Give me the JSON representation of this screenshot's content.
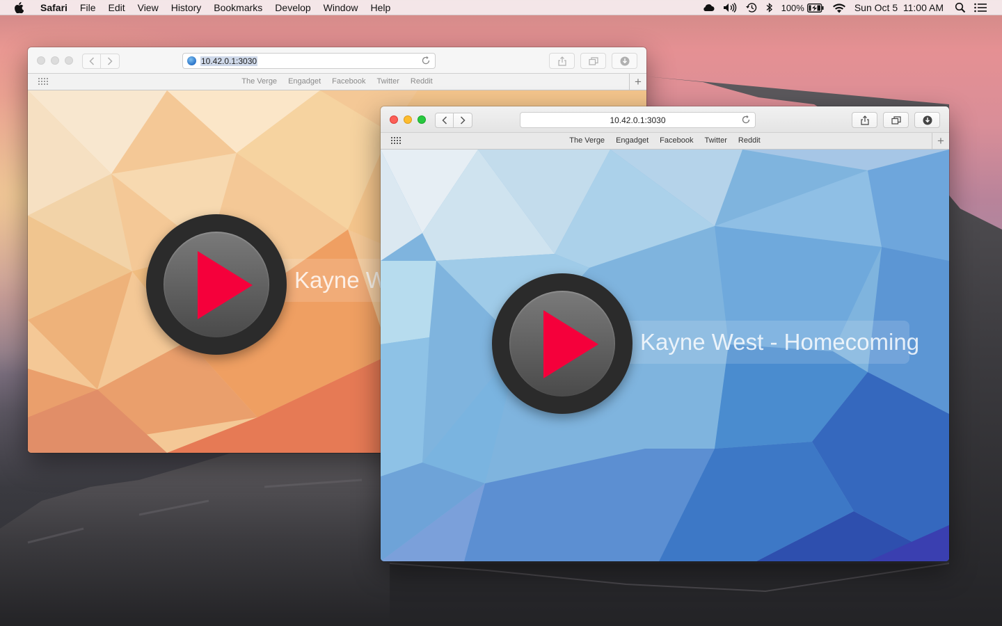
{
  "menubar": {
    "app_name": "Safari",
    "items": [
      "File",
      "Edit",
      "View",
      "History",
      "Bookmarks",
      "Develop",
      "Window",
      "Help"
    ],
    "battery": "100%",
    "datetime": "Sun Oct 5  11:00 AM",
    "icons": [
      "apple-icon",
      "cloud-icon",
      "volume-icon",
      "time-machine-icon",
      "bluetooth-icon",
      "battery-icon",
      "wifi-icon",
      "spotlight-icon",
      "notification-center-icon"
    ]
  },
  "window_back": {
    "url": "10.42.0.1:3030",
    "favorites": [
      "The Verge",
      "Engadget",
      "Facebook",
      "Twitter",
      "Reddit"
    ],
    "track_label": "Kayne West - Homecoming",
    "theme": "orange"
  },
  "window_front": {
    "url": "10.42.0.1:3030",
    "favorites": [
      "The Verge",
      "Engadget",
      "Facebook",
      "Twitter",
      "Reddit"
    ],
    "track_label": "Kayne West - Homecoming",
    "theme": "blue"
  },
  "colors": {
    "play_triangle": "#f5003b",
    "close": "#fc5f57",
    "minimize": "#fdbc2e",
    "maximize": "#28c840"
  }
}
